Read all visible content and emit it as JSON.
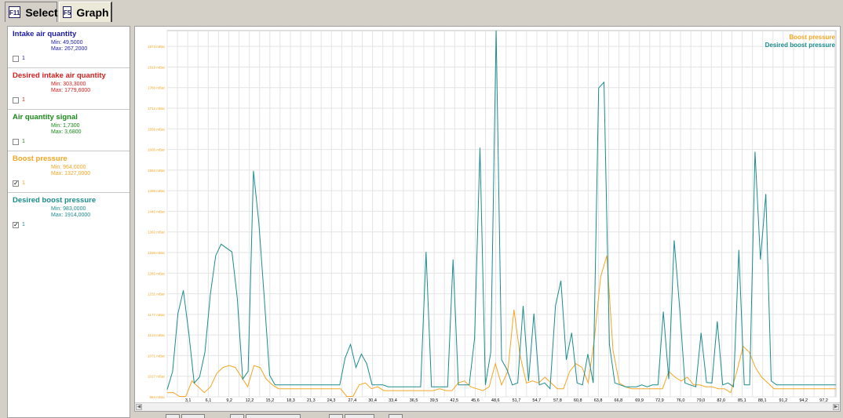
{
  "tabs": [
    {
      "key": "F11",
      "label": "Select"
    },
    {
      "key": "F5",
      "label": "Graph"
    }
  ],
  "signals": [
    {
      "name": "Intake air quantity",
      "min": "Min: 49,5000",
      "max": "Max: 267,2000",
      "color": "#1a1aa8",
      "checked": false,
      "label": "1"
    },
    {
      "name": "Desired intake air quantity",
      "min": "Min: 303,3000",
      "max": "Max: 1779,6000",
      "color": "#d62020",
      "checked": false,
      "label": "1"
    },
    {
      "name": "Air quantity signal",
      "min": "Min: 1,7300",
      "max": "Max: 3,6800",
      "color": "#1a8a1a",
      "checked": false,
      "label": "1"
    },
    {
      "name": "Boost pressure",
      "min": "Min: 964,0000",
      "max": "Max: 1327,0000",
      "color": "#f5a623",
      "checked": true,
      "label": "1"
    },
    {
      "name": "Desired boost pressure",
      "min": "Min: 983,0000",
      "max": "Max: 1914,0000",
      "color": "#1c8c8c",
      "checked": true,
      "label": "1"
    }
  ],
  "chart_data": {
    "type": "line",
    "y_axis_labels": [
      "964 mBar",
      "1017 mBar",
      "1071 mBar",
      "1124 mBar",
      "1177 mBar",
      "1231 mBar",
      "1285 mBar",
      "1338 mBar",
      "1392 mBar",
      "1445 mBar",
      "1498 mBar",
      "1552 mBar",
      "1605 mBar",
      "1659 mBar",
      "1712 mBar",
      "1766 mBar",
      "1819 mBar",
      "1873 mBar"
    ],
    "ylim": [
      964,
      1914
    ],
    "x_ticks": [
      "3,1",
      "6,1",
      "9,2",
      "12,2",
      "15,2",
      "18,3",
      "21,3",
      "24,3",
      "27,4",
      "30,4",
      "33,4",
      "36,5",
      "39,5",
      "42,5",
      "45,6",
      "48,6",
      "51,7",
      "54,7",
      "57,8",
      "60,8",
      "63,8",
      "66,8",
      "69,9",
      "72,9",
      "76,0",
      "79,0",
      "82,0",
      "85,1",
      "88,1",
      "91,2",
      "94,2",
      "97,2"
    ],
    "xlim": [
      0,
      99.0
    ],
    "legend_position": "top-right",
    "series": [
      {
        "name": "Boost pressure",
        "color": "#f5a623",
        "values": [
          975,
          975,
          965,
          965,
          1005,
          990,
          975,
          990,
          1025,
          1040,
          1045,
          1040,
          1015,
          990,
          1045,
          1040,
          1010,
          995,
          985,
          985,
          985,
          985,
          985,
          985,
          985,
          985,
          985,
          985,
          985,
          965,
          965,
          995,
          1000,
          985,
          990,
          980,
          980,
          980,
          980,
          980,
          980,
          980,
          980,
          980,
          985,
          980,
          980,
          1000,
          1005,
          990,
          985,
          980,
          990,
          1050,
          995,
          1030,
          1190,
          1070,
          1000,
          1005,
          1000,
          1015,
          1000,
          985,
          985,
          1030,
          1050,
          1040,
          1000,
          1115,
          1275,
          1330,
          1085,
          1000,
          990,
          985,
          985,
          985,
          985,
          985,
          985,
          1030,
          1015,
          1005,
          1015,
          995,
          995,
          990,
          990,
          985,
          985,
          975,
          1030,
          1095,
          1080,
          1040,
          1015,
          1000,
          985,
          985,
          985,
          985,
          985,
          985,
          985,
          985,
          985,
          985,
          985
        ]
      },
      {
        "name": "Desired boost pressure",
        "color": "#1c8c8c",
        "values": [
          983,
          1030,
          1180,
          1240,
          1130,
          1000,
          1015,
          1080,
          1230,
          1330,
          1360,
          1350,
          1340,
          1220,
          1010,
          1030,
          1550,
          1415,
          1220,
          1020,
          995,
          995,
          995,
          995,
          995,
          995,
          995,
          995,
          995,
          995,
          995,
          995,
          995,
          1065,
          1100,
          1040,
          1075,
          1050,
          995,
          995,
          995,
          990,
          990,
          990,
          990,
          990,
          990,
          990,
          1340,
          990,
          990,
          990,
          990,
          1320,
          995,
          995,
          995,
          1115,
          1610,
          995,
          1080,
          1914,
          1060,
          1035,
          995,
          1000,
          1200,
          1005,
          1180,
          995,
          1000,
          985,
          1200,
          1265,
          1060,
          1130,
          1000,
          995,
          1075,
          1000,
          1765,
          1780,
          1100,
          1000,
          995,
          990,
          990,
          990,
          995,
          990,
          995,
          995,
          1185,
          1010,
          1370,
          1200,
          1000,
          995,
          990,
          1130,
          1001,
          1000,
          1160,
          995,
          1000,
          990,
          1345,
          995,
          995,
          1600,
          1320,
          1490,
          1005,
          995,
          995,
          995,
          995,
          995,
          995,
          995,
          995,
          995,
          995,
          995,
          995
        ]
      }
    ]
  },
  "bottom_buttons": [
    "",
    "",
    "",
    "",
    "",
    "",
    ""
  ]
}
